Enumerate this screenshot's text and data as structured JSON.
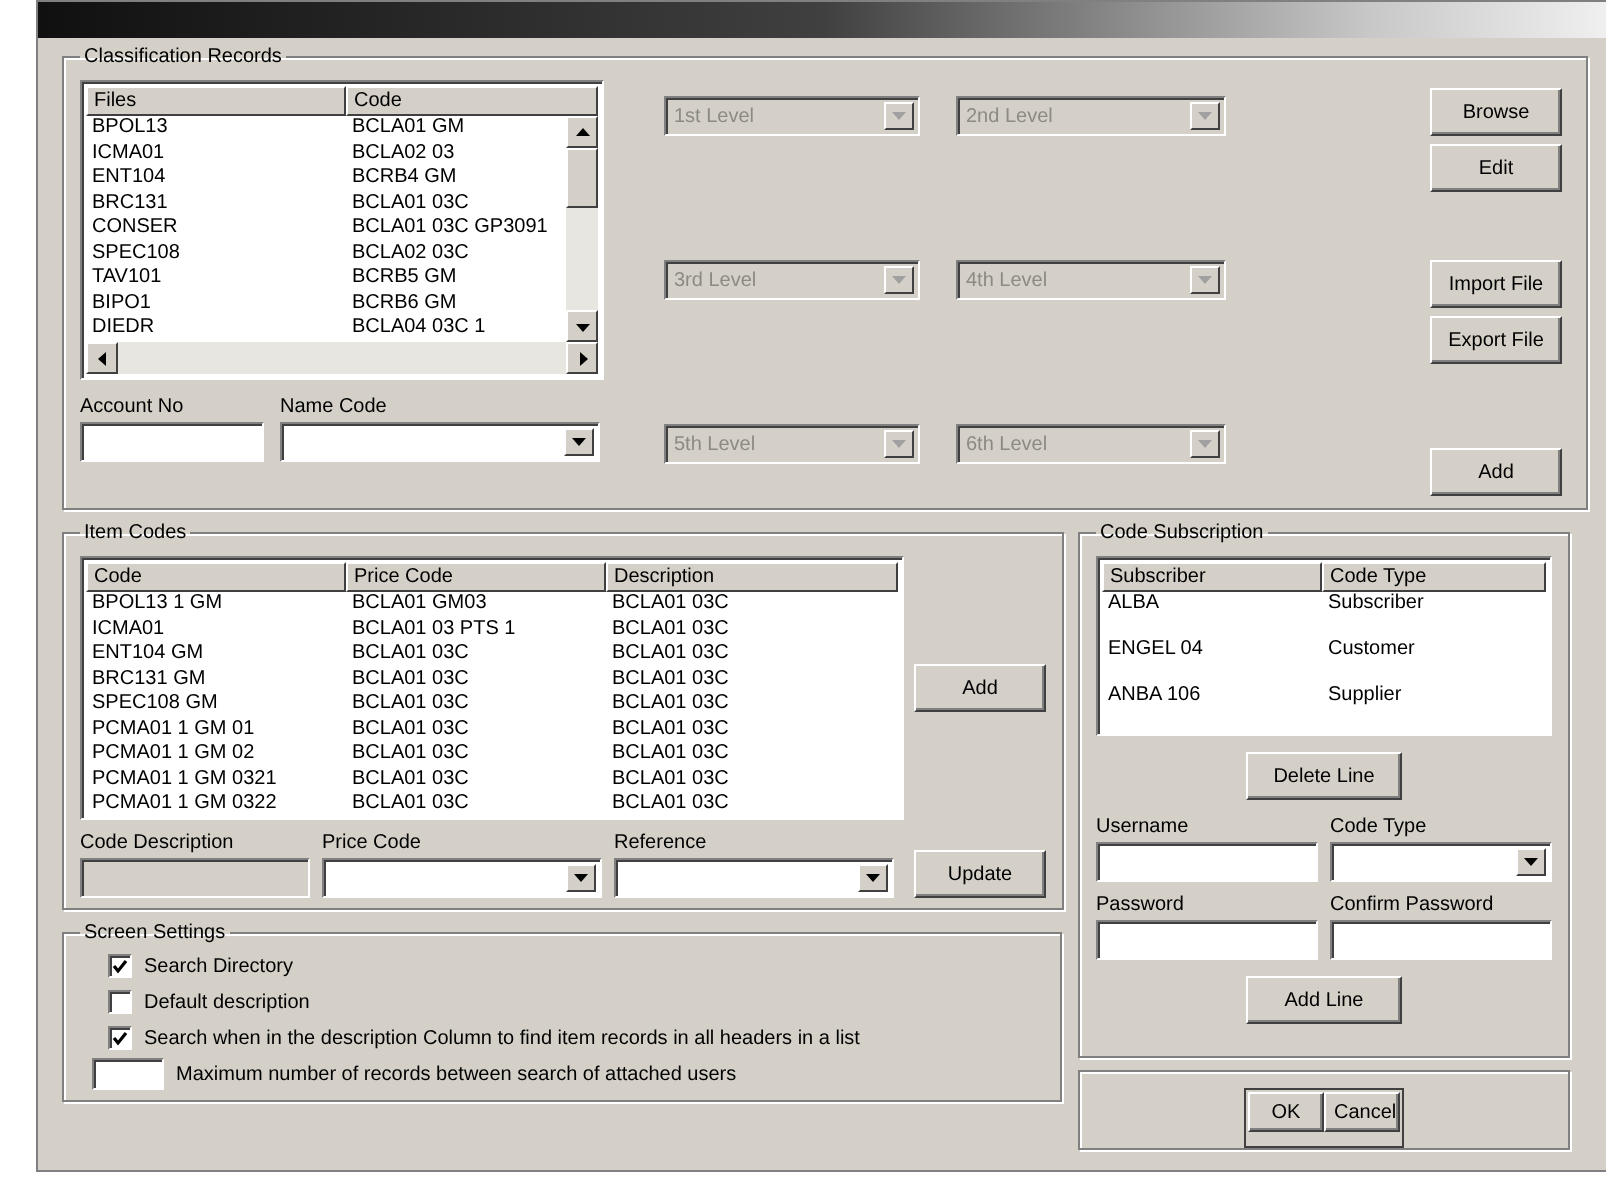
{
  "classification": {
    "title": "Classification Records",
    "list": {
      "columns": [
        "Files",
        "Code"
      ],
      "rows": [
        [
          "BPOL13",
          "BCLA01 GM"
        ],
        [
          "ICMA01",
          "BCLA02 03"
        ],
        [
          "ENT104",
          "BCRB4 GM"
        ],
        [
          "BRC131",
          "BCLA01 03C"
        ],
        [
          "CONSER",
          "BCLA01 03C GP3091"
        ],
        [
          "SPEC108",
          "BCLA02 03C"
        ],
        [
          "TAV101",
          "BCRB5 GM"
        ],
        [
          "BIPO1",
          "BCRB6 GM"
        ],
        [
          "DIEDR",
          "BCLA04 03C 1"
        ]
      ]
    },
    "fields": [
      {
        "label": "Account No",
        "kind": "text"
      },
      {
        "label": "Name Code",
        "kind": "combo"
      }
    ],
    "combos": [
      {
        "value": "1st Level",
        "disabled": true
      },
      {
        "value": "2nd Level",
        "disabled": true
      },
      {
        "value": "3rd Level",
        "disabled": true
      },
      {
        "value": "4th Level",
        "disabled": true
      },
      {
        "value": "5th Level",
        "disabled": true
      },
      {
        "value": "6th Level",
        "disabled": true
      }
    ],
    "buttons": [
      {
        "label": "Browse"
      },
      {
        "label": "Edit"
      },
      {
        "label": "Import File"
      },
      {
        "label": "Export File"
      },
      {
        "label": "Add"
      }
    ]
  },
  "item_codes": {
    "title": "Item Codes",
    "list": {
      "columns": [
        "Code",
        "Price Code",
        "Description"
      ],
      "rows": [
        [
          "BPOL13 1 GM",
          "BCLA01 GM03",
          "BCLA01 03C"
        ],
        [
          "ICMA01",
          "BCLA01 03 PTS 1",
          "BCLA01 03C"
        ],
        [
          "ENT104 GM",
          "BCLA01 03C",
          "BCLA01 03C"
        ],
        [
          "BRC131 GM",
          "BCLA01 03C",
          "BCLA01 03C"
        ],
        [
          "SPEC108 GM",
          "BCLA01 03C",
          "BCLA01 03C"
        ],
        [
          "PCMA01 1 GM 01",
          "BCLA01 03C",
          "BCLA01 03C"
        ],
        [
          "PCMA01 1 GM 02",
          "BCLA01 03C",
          "BCLA01 03C"
        ],
        [
          "PCMA01 1 GM 0321",
          "BCLA01 03C",
          "BCLA01 03C"
        ],
        [
          "PCMA01 1 GM 0322",
          "BCLA01 03C",
          "BCLA01 03C"
        ]
      ]
    },
    "add_button": "Add",
    "fields": [
      {
        "label": "Code Description",
        "kind": "text",
        "disabled": true
      },
      {
        "label": "Price Code",
        "kind": "combo",
        "disabled": false
      },
      {
        "label": "Reference",
        "kind": "combo",
        "disabled": false
      }
    ],
    "update_button": "Update"
  },
  "settings": {
    "title": "Screen Settings",
    "options": [
      {
        "label": "Search Directory",
        "checked": true
      },
      {
        "label": "Default description",
        "checked": false
      },
      {
        "label": "Search when in the description Column to find item records in all headers in a list",
        "checked": true
      }
    ],
    "limit_label": "Maximum number of records between search of attached users"
  },
  "subscription": {
    "title": "Code Subscription",
    "list": {
      "columns": [
        "Subscriber",
        "Code Type"
      ],
      "rows": [
        [
          "ALBA",
          "Subscriber"
        ],
        [
          "ENGEL 04",
          "Customer"
        ],
        [
          "ANBA 106",
          "Supplier"
        ]
      ]
    },
    "delete_button": "Delete Line",
    "fields": [
      {
        "label": "Username",
        "kind": "text"
      },
      {
        "label": "Code Type",
        "kind": "combo"
      },
      {
        "label": "Password",
        "kind": "text"
      },
      {
        "label": "Confirm Password",
        "kind": "text"
      }
    ],
    "add_button": "Add Line"
  },
  "buttons": [
    {
      "label": "OK"
    },
    {
      "label": "Cancel"
    }
  ]
}
